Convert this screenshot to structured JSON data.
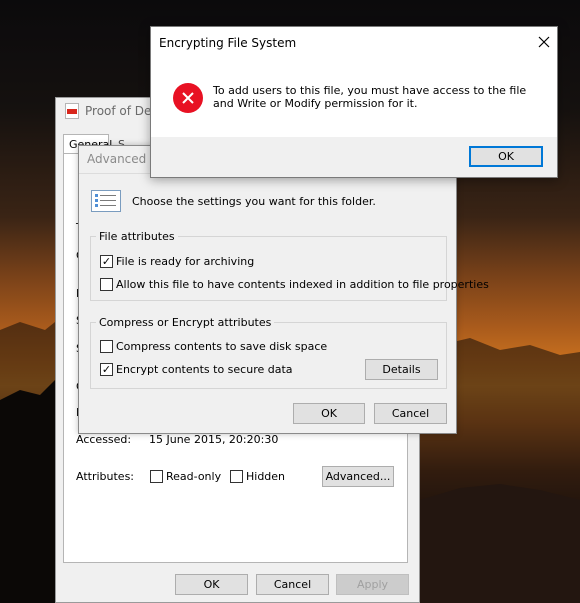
{
  "properties_window": {
    "title": "Proof of Deli",
    "tab_general": "General",
    "tab_next": "S",
    "accessed_label": "Accessed:",
    "accessed_value": "15 June 2015, 20:20:30",
    "attributes_label": "Attributes:",
    "readonly_label": "Read-only",
    "hidden_label": "Hidden",
    "advanced_button": "Advanced...",
    "ok_button": "OK",
    "cancel_button": "Cancel",
    "apply_button": "Apply",
    "left_letters": [
      "T",
      "C",
      "L",
      "S",
      "S",
      "C",
      "N"
    ]
  },
  "advanced_dialog": {
    "title": "Advanced A",
    "intro": "Choose the settings you want for this folder.",
    "file_attributes_title": "File attributes",
    "archive_label": "File is ready for archiving",
    "archive_checked": true,
    "index_label": "Allow this file to have contents indexed in addition to file properties",
    "index_checked": false,
    "compress_group_title": "Compress or Encrypt attributes",
    "compress_label": "Compress contents to save disk space",
    "compress_checked": false,
    "encrypt_label": "Encrypt contents to secure data",
    "encrypt_checked": true,
    "details_button": "Details",
    "ok_button": "OK",
    "cancel_button": "Cancel"
  },
  "error_dialog": {
    "title": "Encrypting File System",
    "message": "To add users to this file, you must have access to the file and Write or Modify permission for it.",
    "ok_button": "OK",
    "icon": "error-icon"
  },
  "colors": {
    "error_red": "#e81123",
    "accent_blue": "#0078d7"
  }
}
